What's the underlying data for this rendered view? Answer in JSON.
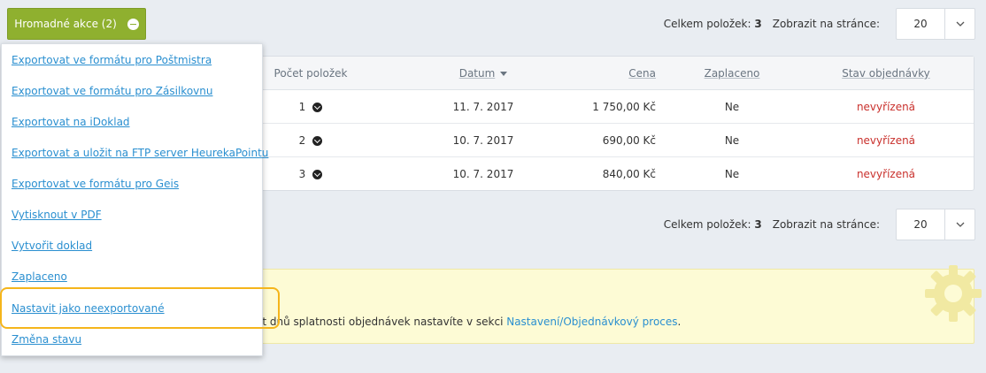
{
  "bulk_actions": {
    "label": "Hromadné akce (2)"
  },
  "pager": {
    "total_label": "Celkem položek:",
    "total_value": "3",
    "show_label": "Zobrazit na stránce:",
    "per_page": "20"
  },
  "menu": {
    "items": [
      "Exportovat ve formátu pro Poštmistra",
      "Exportovat ve formátu pro Zásilkovnu",
      "Exportovat na iDoklad",
      "Exportovat a uložit na FTP server HeurekaPointu",
      "Exportovat ve formátu pro Geis",
      "Vytisknout v PDF",
      "Vytvořit doklad",
      "Zaplaceno",
      "Nastavit jako neexportované",
      "Změna stavu"
    ]
  },
  "table": {
    "headers": {
      "count": "Počet položek",
      "date": "Datum",
      "price": "Cena",
      "paid": "Zaplaceno",
      "state": "Stav objednávky"
    },
    "rows": [
      {
        "count": "1",
        "date": "11. 7. 2017",
        "price": "1 750,00 Kč",
        "paid": "Ne",
        "state": "nevyřízená"
      },
      {
        "count": "2",
        "date": "10. 7. 2017",
        "price": "690,00 Kč",
        "paid": "Ne",
        "state": "nevyřízená"
      },
      {
        "count": "3",
        "date": "10. 7. 2017",
        "price": "840,00 Kč",
        "paid": "Ne",
        "state": "nevyřízená"
      }
    ]
  },
  "notice": {
    "text": "et dnů splatnosti objednávek nastavíte v sekci ",
    "link": "Nastavení/Objednávkový proces",
    "suffix": "."
  },
  "colors": {
    "accent_green": "#8fb02f",
    "link_blue": "#2a8fd0",
    "status_red": "#c9302c",
    "highlight_orange": "#f5b51b"
  }
}
